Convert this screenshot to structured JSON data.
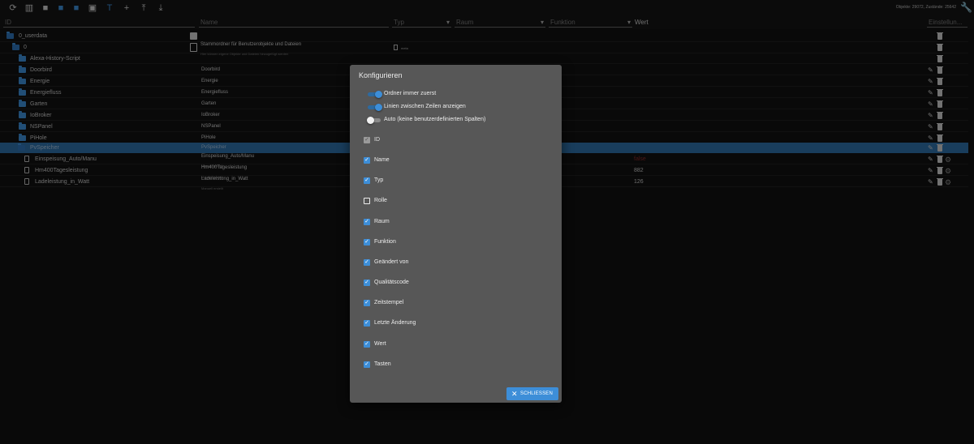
{
  "toolbar": {
    "stats": "Objekte: 29072, Zustände: 25642"
  },
  "header": {
    "id": "ID",
    "name": "Name",
    "typ": "Typ",
    "raum": "Raum",
    "funktion": "Funktion",
    "wert": "Wert",
    "settings": "Einstellun..."
  },
  "tree": {
    "root": {
      "id": "0_userdata",
      "name": "Stammordner für Benutzerobjekte und Dateien",
      "desc": "Hier können eigene Objekte und Dateien hinzugefügt werden"
    },
    "zero": {
      "id": "0",
      "meta": "meta"
    },
    "items": [
      {
        "id": "Alexa-History-Script",
        "name": ""
      },
      {
        "id": "Doorbird",
        "name": "Doorbird"
      },
      {
        "id": "Energie",
        "name": "Energie"
      },
      {
        "id": "Energiefluss",
        "name": "Energiefluss"
      },
      {
        "id": "Garten",
        "name": "Garten"
      },
      {
        "id": "IoBroker",
        "name": "IoBroker"
      },
      {
        "id": "NSPanel",
        "name": "NSPanel"
      },
      {
        "id": "PiHole",
        "name": "PiHole"
      },
      {
        "id": "PvSpeicher",
        "name": "PvSpeicher"
      }
    ],
    "states": [
      {
        "id": "Einspeisung_Auto/Manu",
        "name": "Einspeisung_Auto/Manu",
        "sub": "Manuell erstellt",
        "value": "false"
      },
      {
        "id": "Hm400Tagesleistung",
        "name": "Hm400Tagesleistung",
        "sub": "Manuell erstellt",
        "value": "882"
      },
      {
        "id": "Ladeleistung_in_Watt",
        "name": "Ladeleistung_in_Watt",
        "sub": "Manuell erstellt",
        "value": "126"
      }
    ]
  },
  "dialog": {
    "title": "Konfigurieren",
    "switches": [
      {
        "label": "Ordner immer zuerst",
        "on": true
      },
      {
        "label": "Linien zwischen Zeilen anzeigen",
        "on": true
      },
      {
        "label": "Auto (keine benutzerdefinierten Spalten)",
        "on": false
      }
    ],
    "columns": [
      {
        "label": "ID",
        "checked": true,
        "disabled": true
      },
      {
        "label": "Name",
        "checked": true
      },
      {
        "label": "Typ",
        "checked": true
      },
      {
        "label": "Rolle",
        "checked": false
      },
      {
        "label": "Raum",
        "checked": true
      },
      {
        "label": "Funktion",
        "checked": true
      },
      {
        "label": "Geändert von",
        "checked": true
      },
      {
        "label": "Qualitätscode",
        "checked": true
      },
      {
        "label": "Zeitstempel",
        "checked": true
      },
      {
        "label": "Letzte Änderung",
        "checked": true
      },
      {
        "label": "Wert",
        "checked": true
      },
      {
        "label": "Tasten",
        "checked": true
      }
    ],
    "close_label": "SCHLIESSEN"
  },
  "colors": {
    "accent": "#3d8ed8",
    "selected_row": "#2f6fa8",
    "dialog_bg": "#575757"
  }
}
